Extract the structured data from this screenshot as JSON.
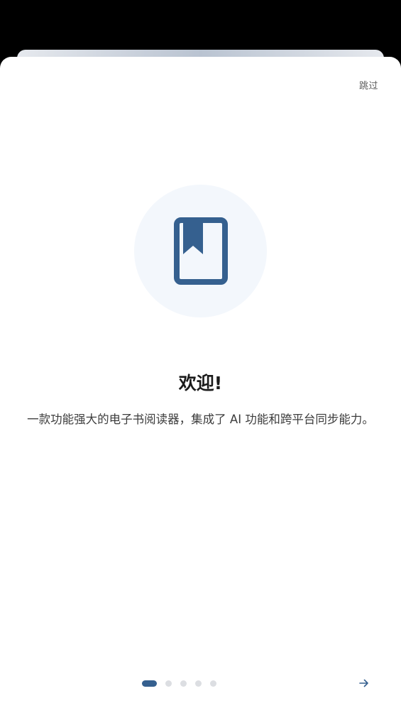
{
  "onboarding": {
    "skip_label": "跳过",
    "title": "欢迎!",
    "description": "一款功能强大的电子书阅读器，集成了 AI 功能和跨平台同步能力。",
    "hero_icon": "book-bookmark-icon",
    "next_icon": "arrow-right-icon",
    "pages_total": 5,
    "current_page": 1
  },
  "colors": {
    "accent": "#35608f",
    "hero_bg": "#f3f7fc",
    "dot_inactive": "#dcdee2"
  }
}
